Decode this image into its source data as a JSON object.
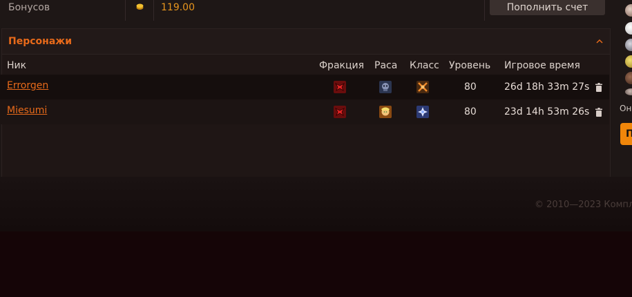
{
  "balance": {
    "label": "Бонусов",
    "value": "119.00",
    "topup_label": "Пополнить счет"
  },
  "characters": {
    "title": "Персонажи",
    "columns": {
      "nick": "Ник",
      "faction": "Фракция",
      "race": "Раса",
      "class": "Класс",
      "level": "Уровень",
      "playtime": "Игровое время"
    },
    "rows": [
      {
        "nick": "Errorgen",
        "faction_icon": "horde-icon",
        "race_icon": "undead-icon",
        "class_icon": "warrior-icon",
        "level": "80",
        "playtime": "26d 18h 33m 27s"
      },
      {
        "nick": "Miesumi",
        "faction_icon": "horde-icon",
        "race_icon": "blood-elf-icon",
        "class_icon": "priest-icon",
        "level": "80",
        "playtime": "23d 14h 53m 26s"
      }
    ]
  },
  "footer": {
    "copyright": "© 2010—2023 Компл"
  },
  "sidebar": {
    "online_label": "Он",
    "button_label": "П"
  },
  "colors": {
    "accent": "#e86a1a",
    "gold": "#e8961e",
    "cta": "#f0860a"
  }
}
